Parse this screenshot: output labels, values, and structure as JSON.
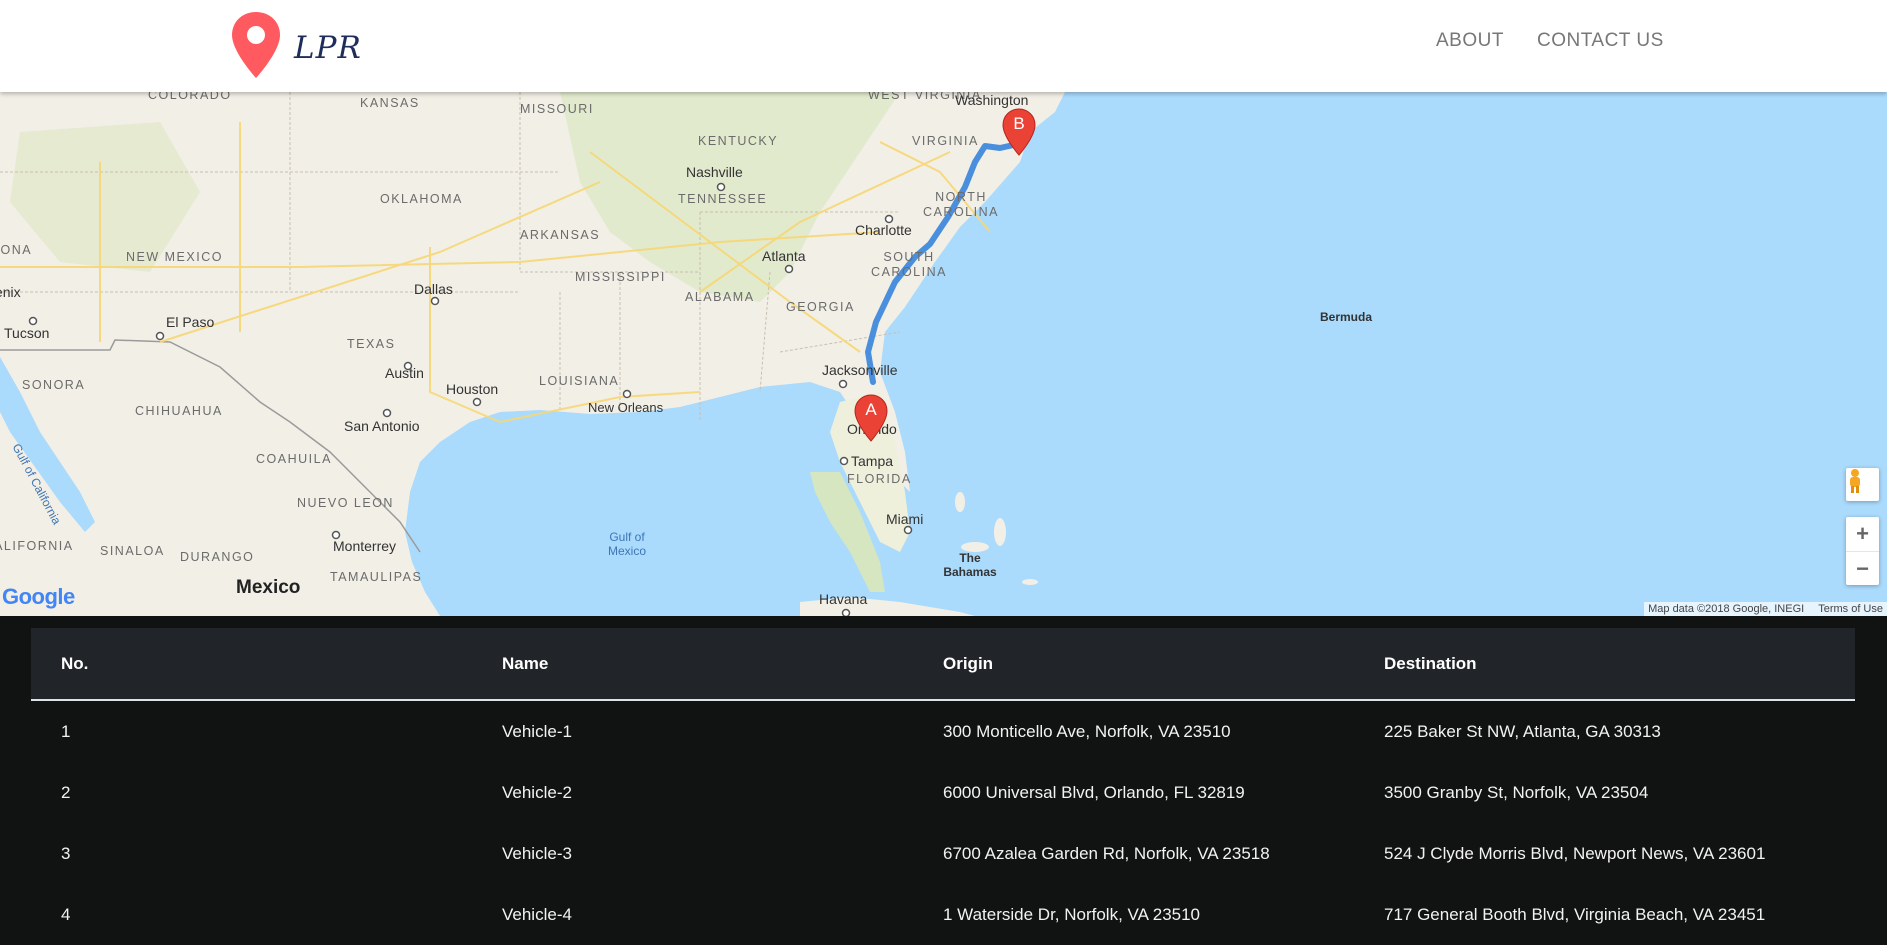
{
  "navbar": {
    "logo_text": "LPR",
    "links": [
      "ABOUT",
      "CONTACT US"
    ]
  },
  "map": {
    "states": [
      "COLORADO",
      "KANSAS",
      "MISSOURI",
      "WEST VIRGINIA",
      "KENTUCKY",
      "VIRGINIA",
      "OKLAHOMA",
      "TENNESSEE",
      "NORTH CAROLINA",
      "ARKANSAS",
      "SOUTH CAROLINA",
      "NEW MEXICO",
      "MISSISSIPPI",
      "ALABAMA",
      "GEORGIA",
      "ARIZONA",
      "TEXAS",
      "LOUISIANA",
      "FLORIDA",
      "SONORA",
      "CHIHUAHUA",
      "COAHUILA",
      "NUEVO LEON",
      "SINALOA",
      "DURANGO",
      "TAMAULIPAS",
      "BAJA CALIFORNIA SUR"
    ],
    "cities": [
      "Washington",
      "Nashville",
      "Charlotte",
      "Atlanta",
      "Dallas",
      "El Paso",
      "Tucson",
      "Phoenix",
      "Austin",
      "Houston",
      "New Orleans",
      "Jacksonville",
      "Orlando",
      "Tampa",
      "San Antonio",
      "Miami",
      "Monterrey",
      "Havana",
      "Mexico",
      "Bermuda",
      "The Bahamas"
    ],
    "water": [
      "Gulf of Mexico",
      "Gulf of California"
    ],
    "markers": [
      "A",
      "B"
    ],
    "attribution": "Map data ©2018 Google, INEGI",
    "terms": "Terms of Use",
    "google_logo": "Google",
    "zoom_in": "+",
    "zoom_out": "−"
  },
  "table": {
    "headers": [
      "No.",
      "Name",
      "Origin",
      "Destination"
    ],
    "rows": [
      [
        "1",
        "Vehicle-1",
        "300 Monticello Ave, Norfolk, VA 23510",
        "225 Baker St NW, Atlanta, GA 30313"
      ],
      [
        "2",
        "Vehicle-2",
        "6000 Universal Blvd, Orlando, FL 32819",
        "3500 Granby St, Norfolk, VA 23504"
      ],
      [
        "3",
        "Vehicle-3",
        "6700 Azalea Garden Rd, Norfolk, VA 23518",
        "524 J Clyde Morris Blvd, Newport News, VA 23601"
      ],
      [
        "4",
        "Vehicle-4",
        "1 Waterside Dr, Norfolk, VA 23510",
        "717 General Booth Blvd, Virginia Beach, VA 23451"
      ]
    ]
  },
  "colors": {
    "marker_red": "#ea4335",
    "route_blue": "#4a8fde",
    "table_header_bg": "#212529",
    "page_bg": "#111313",
    "water": "#aadafc",
    "land": "#f2efe6"
  }
}
